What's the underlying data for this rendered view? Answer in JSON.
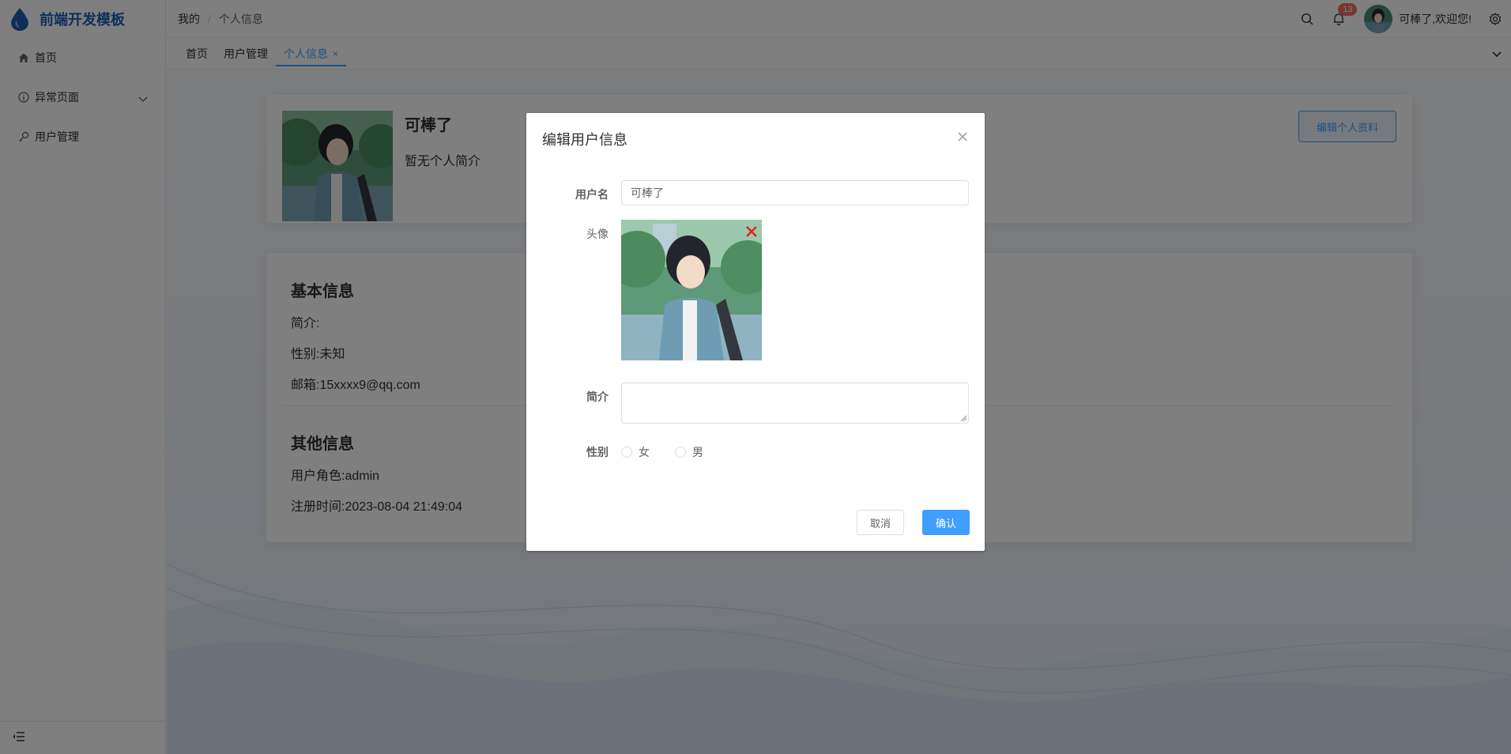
{
  "app": {
    "title": "前端开发模板"
  },
  "sidebar": {
    "items": [
      {
        "label": "首页",
        "icon": "home-icon"
      },
      {
        "label": "异常页面",
        "icon": "info-icon",
        "has_submenu": true
      },
      {
        "label": "用户管理",
        "icon": "key-icon"
      }
    ],
    "collapse_icon": "collapse-menu-icon"
  },
  "header": {
    "breadcrumb": [
      "我的",
      "个人信息"
    ],
    "breadcrumb_sep": "/",
    "notifications_count": "13",
    "welcome": "可棒了,欢迎您!"
  },
  "tabs": [
    {
      "label": "首页",
      "active": false
    },
    {
      "label": "用户管理",
      "active": false
    },
    {
      "label": "个人信息",
      "active": true,
      "close": "×"
    }
  ],
  "profile": {
    "name": "可棒了",
    "bio": "暂无个人简介",
    "edit_button": "编辑个人资料"
  },
  "basic_info": {
    "title": "基本信息",
    "intro": "简介:",
    "gender": "性别:未知",
    "email": "邮箱:15xxxx9@qq.com"
  },
  "other_info": {
    "title": "其他信息",
    "role": "用户角色:admin",
    "registered": "注册时间:2023-08-04 21:49:04"
  },
  "dialog": {
    "title": "编辑用户信息",
    "username_label": "用户名",
    "username_value": "可棒了",
    "avatar_label": "头像",
    "bio_label": "简介",
    "gender_label": "性别",
    "gender_options": [
      "女",
      "男"
    ],
    "cancel": "取消",
    "confirm": "确认"
  },
  "colors": {
    "primary": "#409eff",
    "badge": "#f56c6c",
    "brand": "#1f5fb5",
    "remove_x": "#e02020"
  }
}
